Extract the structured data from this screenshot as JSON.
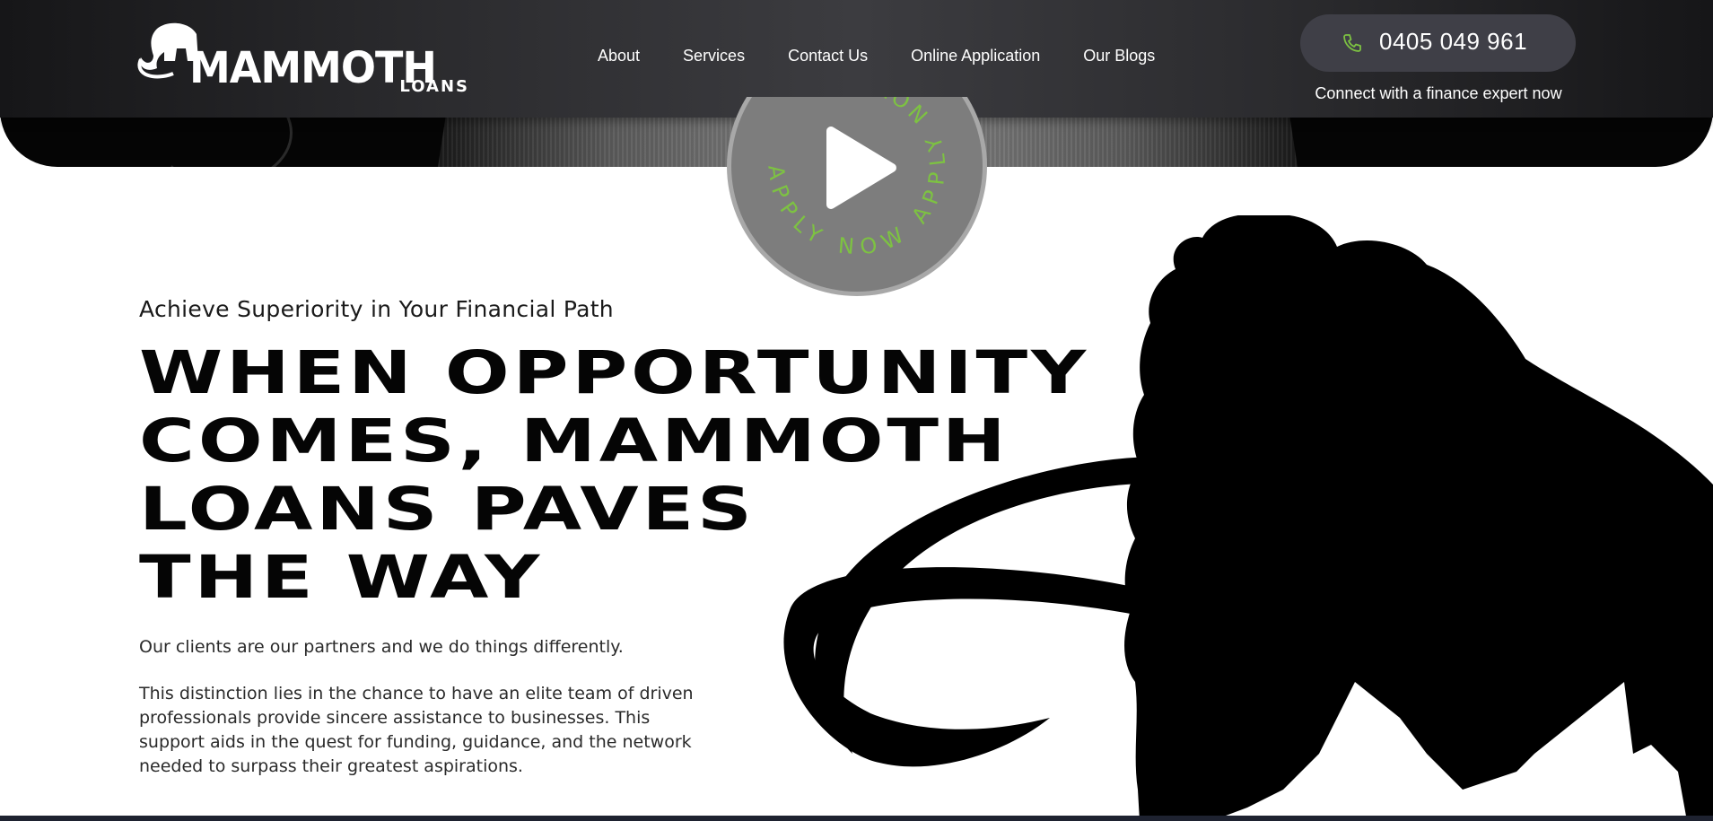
{
  "brand": {
    "name": "MAMMOTH",
    "sub": "LOANS"
  },
  "nav": {
    "items": [
      {
        "label": "About"
      },
      {
        "label": "Services"
      },
      {
        "label": "Contact Us"
      },
      {
        "label": "Online Application"
      },
      {
        "label": "Our Blogs"
      }
    ]
  },
  "contact": {
    "phone": "0405 049 961",
    "tagline": "Connect with a finance expert now",
    "icon": "phone-icon"
  },
  "apply_badge": {
    "ring_text": "APPLY NOW APPLY NOW",
    "icon": "play-icon"
  },
  "hero": {
    "eyebrow": "Achieve Superiority in Your Financial Path",
    "headline_lines": [
      "WHEN OPPORTUNITY",
      "COMES, MAMMOTH",
      "LOANS PAVES",
      "THE WAY"
    ],
    "lead": "Our clients are our partners and we do things differently.",
    "body": "This distinction lies in the chance to have an elite team of driven professionals provide sincere assistance to businesses. This support aids in the quest for funding, guidance, and the network needed to surpass their greatest aspirations."
  },
  "colors": {
    "accent": "#7dc242",
    "header_bg": "#2f2f33",
    "phone_btn_bg": "#3f3f47",
    "text_dark": "#050505"
  }
}
